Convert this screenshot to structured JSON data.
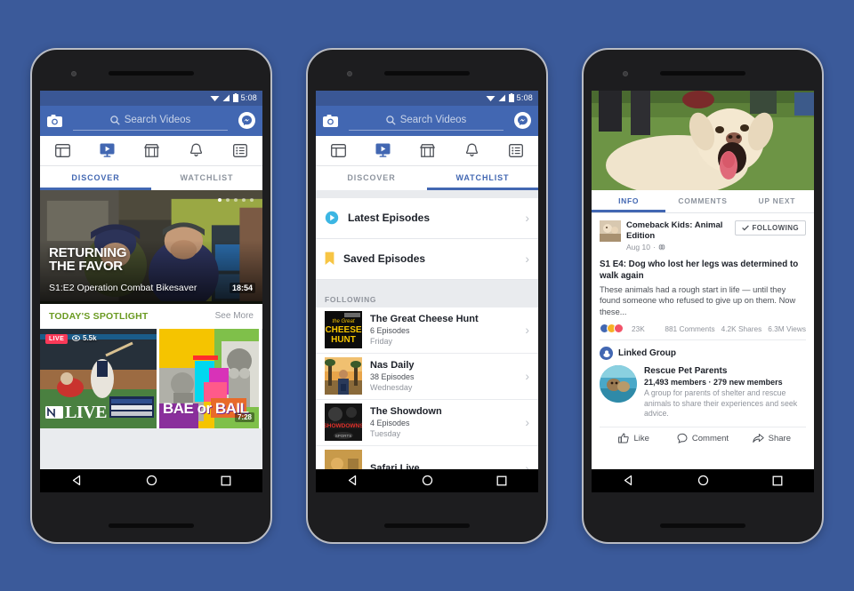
{
  "background_color": "#3b5a9a",
  "brand": {
    "blue": "#4267b2",
    "dark_blue": "#3a5795",
    "green": "#6a9a21",
    "red": "#fb3958"
  },
  "status_bar": {
    "time": "5:08",
    "wifi_icon": "wifi-icon",
    "signal_icon": "signal-icon",
    "battery_icon": "battery-icon"
  },
  "search": {
    "placeholder": "Search Videos",
    "camera_icon": "camera-icon",
    "search_icon": "search-icon",
    "messenger_icon": "messenger-icon"
  },
  "nav_icons": [
    {
      "name": "news-feed-icon",
      "label": "News Feed"
    },
    {
      "name": "video-icon",
      "label": "Video"
    },
    {
      "name": "marketplace-icon",
      "label": "Marketplace"
    },
    {
      "name": "notifications-bell-icon",
      "label": "Notifications"
    },
    {
      "name": "menu-list-icon",
      "label": "Menu"
    }
  ],
  "android_nav": {
    "back_icon": "back-triangle-icon",
    "home_icon": "home-circle-icon",
    "recents_icon": "recents-square-icon"
  },
  "phone1": {
    "segments": [
      {
        "label": "DISCOVER",
        "active": true
      },
      {
        "label": "WATCHLIST",
        "active": false
      }
    ],
    "hero": {
      "title_line1": "RETURNING",
      "title_line2": "THE FAVOR",
      "subtitle": "S1:E2 Operation Combat Bikesaver",
      "duration": "18:54",
      "dots_total": 5,
      "dots_active_index": 0
    },
    "spotlight": {
      "heading": "TODAY'S SPOTLIGHT",
      "see_more": "See More",
      "cards": [
        {
          "type": "live",
          "live_label": "LIVE",
          "viewers": "5.5k",
          "eye_icon": "eye-icon",
          "overlay_text": "LIVE",
          "brand": "MLB"
        },
        {
          "type": "video",
          "overlay_text": "BAE or BAIL",
          "duration": "7:28"
        }
      ]
    }
  },
  "phone2": {
    "segments": [
      {
        "label": "DISCOVER",
        "active": false
      },
      {
        "label": "WATCHLIST",
        "active": true
      }
    ],
    "quick_rows": [
      {
        "label": "Latest Episodes",
        "icon": "play-circle-icon",
        "color": "#3cb6e3"
      },
      {
        "label": "Saved Episodes",
        "icon": "bookmark-icon",
        "color": "#f7c544"
      }
    ],
    "following_heading": "FOLLOWING",
    "shows": [
      {
        "name": "The Great Cheese Hunt",
        "episodes": "6 Episodes",
        "day": "Friday",
        "thumb": "cheese-hunt-thumb"
      },
      {
        "name": "Nas Daily",
        "episodes": "38 Episodes",
        "day": "Wednesday",
        "thumb": "nas-daily-thumb"
      },
      {
        "name": "The Showdown",
        "episodes": "4 Episodes",
        "day": "Tuesday",
        "thumb": "showdown-thumb"
      },
      {
        "name": "Safari Live",
        "episodes": "",
        "day": "",
        "thumb": "safari-live-thumb"
      }
    ]
  },
  "phone3": {
    "photo": "golden-retriever-photo",
    "tabs": [
      {
        "label": "INFO",
        "active": true
      },
      {
        "label": "COMMENTS",
        "active": false
      },
      {
        "label": "UP NEXT",
        "active": false
      }
    ],
    "post": {
      "page_name": "Comeback Kids: Animal Edition",
      "date": "Aug 10",
      "privacy_icon": "globe-icon",
      "following_label": "FOLLOWING",
      "check_icon": "check-icon",
      "title": "S1 E4: Dog who lost her legs was determined to walk again",
      "description": "These animals had a rough start in life — until they found someone who refused to give up on them. Now these...",
      "reaction_count": "23K",
      "comments": "881 Comments",
      "shares": "4.2K Shares",
      "views": "6.3M Views"
    },
    "linked_group": {
      "label": "Linked Group",
      "group_icon": "group-badge-icon",
      "name": "Rescue Pet Parents",
      "members": "21,493 members · 279 new members",
      "description": "A group for parents of shelter and rescue animals to share their experiences and seek advice."
    },
    "actions": [
      {
        "label": "Like",
        "icon": "thumbs-up-icon"
      },
      {
        "label": "Comment",
        "icon": "comment-bubble-icon"
      },
      {
        "label": "Share",
        "icon": "share-arrow-icon"
      }
    ]
  }
}
